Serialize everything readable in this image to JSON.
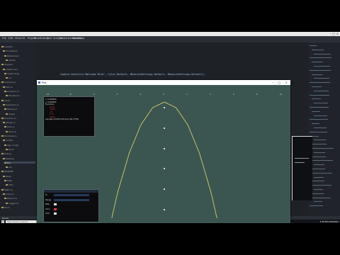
{
  "ide": {
    "title": "",
    "menu": [
      "File",
      "Edit",
      "View",
      "Git",
      "Project",
      "Build",
      "Debug",
      "Test",
      "Analyze",
      "Tools",
      "Extensions",
      "Window",
      "Help"
    ],
    "code_top": "Camera.Controls(\"Welcome Blue\", Color.Default, MeasureSettings.Default, MeasureSettings.Default);",
    "code_bottom": [
      "point[i].x = x;",
      "points[i] = x+(float);",
      "plot.PlotPoints(points);",
      "",
      "}"
    ],
    "status_text": "Ready",
    "explorer_items": [
      "Solution",
      "CloudDraw",
      "References",
      "Assets",
      "Shaders",
      "shader.vert",
      "shader.frag",
      "src",
      "Camera.cs",
      "Plot.cs",
      "Program.cs",
      "Window.cs",
      "Input",
      "Keyboard.cs",
      "Mouse.cs",
      "Graph",
      "Function.cs",
      "Series.cs",
      "Axis.cs",
      "Grid.cs",
      "Renderer.cs",
      "Config",
      "App.config",
      "Build",
      "Debug",
      "Release",
      "bin",
      "obj",
      "README",
      "Tests",
      "Data",
      "Utils",
      "Math.cs",
      "Color.cs",
      "Export.cs",
      "Logger.cs",
      "Docs"
    ]
  },
  "taskbar": {
    "search_placeholder": "Type here to search",
    "clock_time": "4:36 PM",
    "clock_date": "2/20/2021"
  },
  "app_window": {
    "title": "Plot",
    "panel1": {
      "lines": [
        "x: 0.000000",
        "y: 0.000000",
        "Functions",
        "sin(x)",
        "cos(x)",
        "x*x",
        "x^3",
        "log(x)",
        "Average 16.667ms/frame (60.0 FPS)"
      ]
    },
    "panel2": {
      "labels": [
        "Fn",
        "Range",
        "Step",
        "Color",
        "Grid"
      ]
    }
  },
  "chart_data": {
    "type": "line",
    "title": "",
    "xlabel": "",
    "ylabel": "",
    "x_ticks": [
      "-10",
      "-8",
      "-6",
      "-4",
      "-2",
      "0",
      "2",
      "4",
      "6",
      "8",
      "10"
    ],
    "y_ticks": [
      "10",
      "8",
      "6",
      "4",
      "2",
      "0"
    ],
    "series": [
      {
        "x": [
          -4.5,
          -4,
          -3,
          -2,
          -1,
          0,
          1,
          2,
          3,
          4,
          4.5
        ],
        "y": [
          -2.25,
          0,
          3.5,
          6,
          7.5,
          8,
          7.5,
          6,
          3.5,
          0,
          -2.25
        ],
        "color": "#d6cc6a"
      }
    ],
    "xlim": [
      -10,
      10
    ],
    "ylim": [
      -3,
      9
    ],
    "grid": false
  },
  "colors": {
    "plot_bg": "#3b5650",
    "curve": "#d6cc6a",
    "panel_bg": "#0c0c0e",
    "accent": "#e04242"
  }
}
